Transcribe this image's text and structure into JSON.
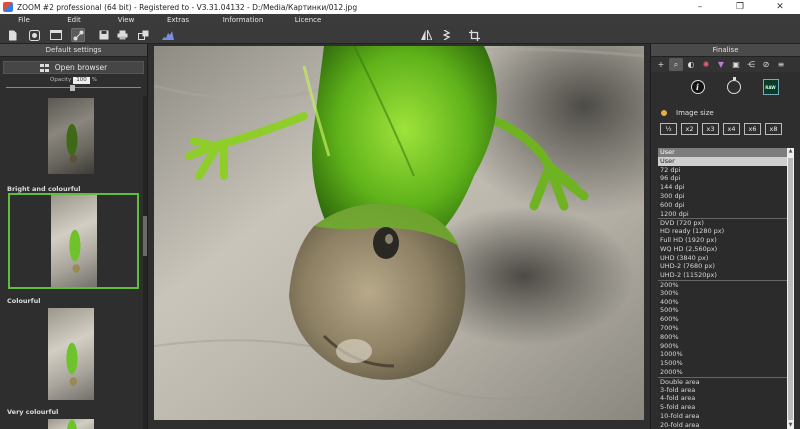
{
  "window": {
    "title": "ZOOM #2 professional (64 bit) - Registered to - V3.31.04132 - D:/Media/Картинки/012.jpg",
    "minimize": "–",
    "maximize": "❐",
    "close": "✕"
  },
  "menu": [
    "File",
    "Edit",
    "View",
    "Extras",
    "Information",
    "Licence"
  ],
  "toolbar": {
    "icons": [
      "file-icon",
      "eye-icon",
      "window-icon",
      "nodes-icon",
      "save-icon",
      "print-icon",
      "batch-icon",
      "histogram-icon",
      "mirror-icon",
      "rotate-icon",
      "crop-icon"
    ],
    "active": "nodes-icon"
  },
  "left_panel": {
    "title": "Default settings",
    "open_browser": "Open browser",
    "opacity_label": "Opacity",
    "opacity_value": "100",
    "opacity_unit": "%",
    "presets": [
      {
        "label": "",
        "tone": "dark"
      },
      {
        "label": "Bright and colourful",
        "tone": "vivid",
        "selected": true
      },
      {
        "label": "Colourful",
        "tone": "vivid"
      },
      {
        "label": "Very colourful",
        "tone": "vivid"
      }
    ]
  },
  "right_panel": {
    "title": "Finalise",
    "tools": [
      "plus-icon",
      "zoom-icon",
      "circle-half-icon",
      "color-wheel-icon",
      "triangle-icon",
      "filter-icon",
      "share-icon",
      "magic-icon",
      "menu-icon"
    ],
    "sub_icons": [
      "info-icon",
      "timer-icon",
      "raw-icon"
    ],
    "raw_label": "RAW",
    "image_size_label": "Image size",
    "scale_buttons": [
      "½",
      "x2",
      "x3",
      "x4",
      "x6",
      "x8"
    ],
    "size_options": [
      {
        "text": "User",
        "style": "header"
      },
      {
        "text": "User",
        "style": "sel"
      },
      {
        "text": "72 dpi"
      },
      {
        "text": "96 dpi"
      },
      {
        "text": "144 dpi"
      },
      {
        "text": "300 dpi"
      },
      {
        "text": "600 dpi"
      },
      {
        "text": "1200 dpi"
      },
      {
        "text": "DVD (720 px)",
        "style": "sep"
      },
      {
        "text": "HD ready (1280 px)"
      },
      {
        "text": "Full HD (1920 px)"
      },
      {
        "text": "WQ HD (2,560px)"
      },
      {
        "text": "UHD (3840 px)"
      },
      {
        "text": "UHD-2 (7680 px)"
      },
      {
        "text": "UHD-2 (11520px)"
      },
      {
        "text": "200%",
        "style": "sep"
      },
      {
        "text": "300%"
      },
      {
        "text": "400%"
      },
      {
        "text": "500%"
      },
      {
        "text": "600%"
      },
      {
        "text": "700%"
      },
      {
        "text": "800%"
      },
      {
        "text": "900%"
      },
      {
        "text": "1000%"
      },
      {
        "text": "1500%"
      },
      {
        "text": "2000%"
      },
      {
        "text": "Double area",
        "style": "sep"
      },
      {
        "text": "3-fold area"
      },
      {
        "text": "4-fold area"
      },
      {
        "text": "5-fold area"
      },
      {
        "text": "10-fold area"
      },
      {
        "text": "20-fold area"
      }
    ]
  },
  "colors": {
    "selection_border": "#5fbf3a",
    "panel_bg": "#2e2e2e",
    "header_bg": "#4a4a4a"
  }
}
